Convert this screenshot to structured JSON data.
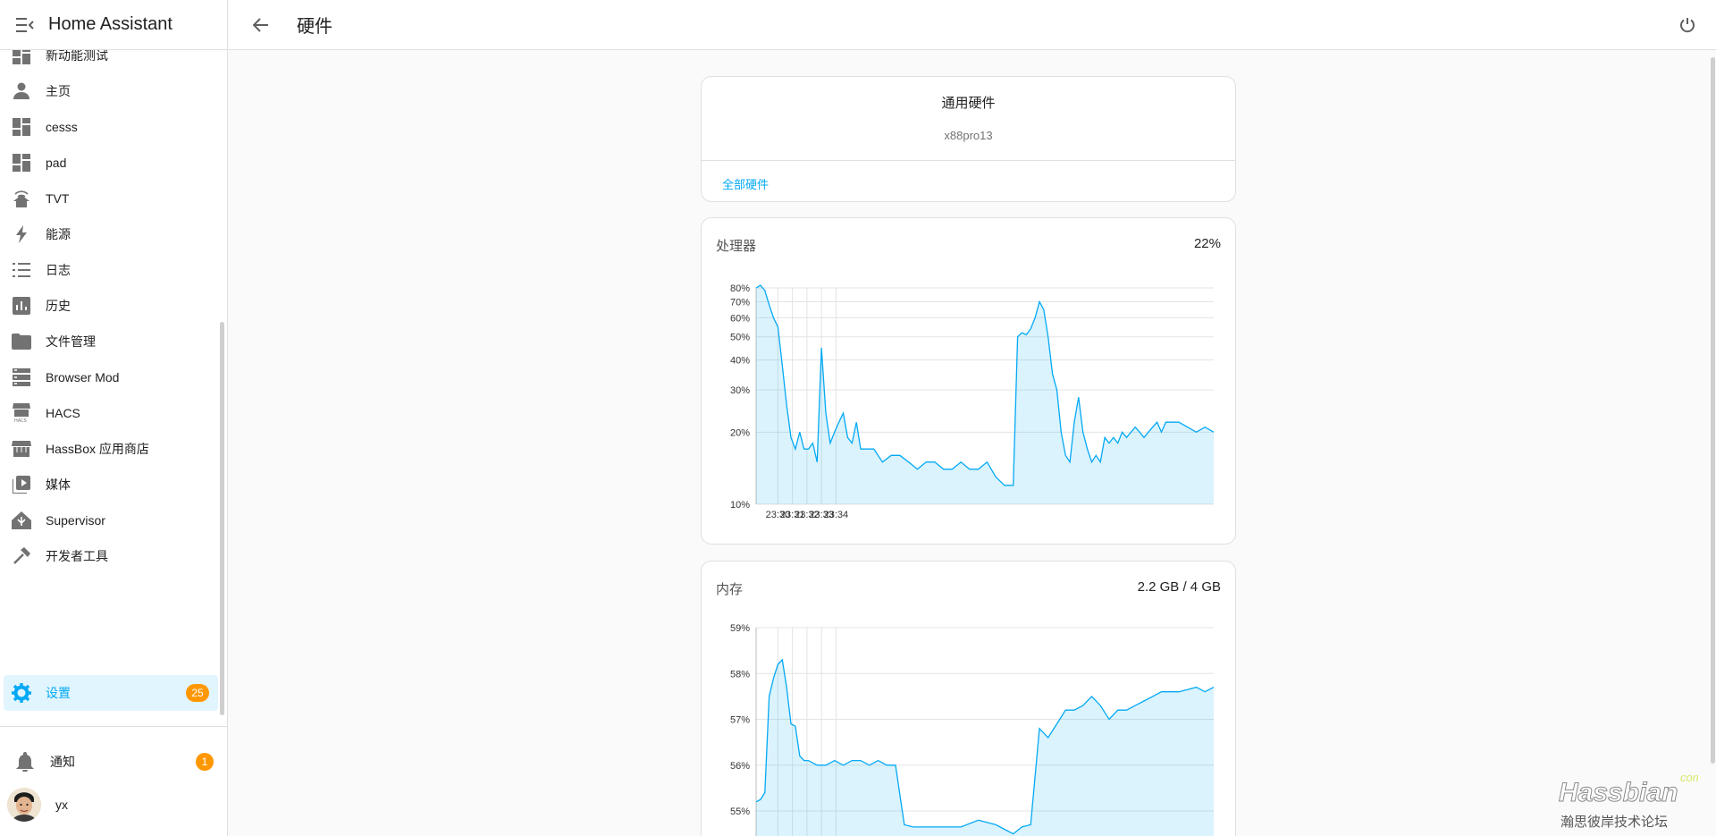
{
  "app": {
    "title": "Home Assistant"
  },
  "sidebar": {
    "partial_item": "新动能测试",
    "items": [
      {
        "label": "主页",
        "icon": "person-icon"
      },
      {
        "label": "cesss",
        "icon": "dashboard-icon"
      },
      {
        "label": "pad",
        "icon": "dashboard-icon"
      },
      {
        "label": "TVT",
        "icon": "home-signal-icon"
      },
      {
        "label": "能源",
        "icon": "lightning-icon"
      },
      {
        "label": "日志",
        "icon": "list-icon"
      },
      {
        "label": "历史",
        "icon": "chart-box-icon"
      },
      {
        "label": "文件管理",
        "icon": "folder-icon"
      },
      {
        "label": "Browser Mod",
        "icon": "server-icon"
      },
      {
        "label": "HACS",
        "icon": "hacs-store-icon"
      },
      {
        "label": "HassBox 应用商店",
        "icon": "store-icon"
      },
      {
        "label": "媒体",
        "icon": "play-box-icon"
      },
      {
        "label": "Supervisor",
        "icon": "supervisor-icon"
      },
      {
        "label": "开发者工具",
        "icon": "hammer-icon"
      },
      {
        "label": "设置",
        "icon": "gear-icon",
        "badge": "25",
        "active": true
      }
    ],
    "notifications": {
      "label": "通知",
      "badge": "1"
    },
    "user": {
      "name": "yx"
    }
  },
  "header": {
    "title": "硬件"
  },
  "general": {
    "title": "通用硬件",
    "subtitle": "x88pro13",
    "link": "全部硬件"
  },
  "cpu": {
    "label": "处理器",
    "value": "22%"
  },
  "memory": {
    "label": "内存",
    "value": "2.2 GB / 4 GB"
  },
  "watermark": {
    "brand": "Hassbian",
    "suffix": "com",
    "tagline": "瀚思彼岸技术论坛"
  },
  "chart_data": [
    {
      "type": "area",
      "name": "cpu",
      "y_ticks": [
        "10%",
        "20%",
        "30%",
        "40%",
        "50%",
        "60%",
        "70%",
        "80%"
      ],
      "x_ticks": [
        "23:30",
        "23:31",
        "23:32",
        "23:33",
        "23:34"
      ],
      "y_log": true,
      "ylim": [
        10,
        80
      ],
      "xlim": [
        23.475,
        24.0
      ],
      "x": [
        23.475,
        23.48,
        23.485,
        23.49,
        23.495,
        23.5,
        23.505,
        23.51,
        23.515,
        23.52,
        23.525,
        23.53,
        23.535,
        23.54,
        23.545,
        23.55,
        23.555,
        23.56,
        23.565,
        23.57,
        23.575,
        23.58,
        23.585,
        23.59,
        23.595,
        23.6,
        23.61,
        23.62,
        23.63,
        23.64,
        23.65,
        23.66,
        23.67,
        23.68,
        23.69,
        23.7,
        23.71,
        23.72,
        23.73,
        23.74,
        23.75,
        23.76,
        23.765,
        23.77,
        23.775,
        23.78,
        23.785,
        23.79,
        23.795,
        23.8,
        23.805,
        23.81,
        23.815,
        23.82,
        23.825,
        23.83,
        23.835,
        23.84,
        23.845,
        23.85,
        23.855,
        23.86,
        23.865,
        23.87,
        23.875,
        23.88,
        23.885,
        23.89,
        23.895,
        23.9,
        23.905,
        23.91,
        23.915,
        23.92,
        23.925,
        23.93,
        23.935,
        23.94,
        23.945,
        23.95,
        23.96,
        23.97,
        23.98,
        23.99,
        24.0
      ],
      "values": [
        80,
        82,
        78,
        68,
        60,
        55,
        38,
        26,
        19,
        17,
        20,
        17,
        17,
        18,
        15,
        45,
        24,
        18,
        20,
        22,
        24,
        19,
        18,
        22,
        17,
        17,
        17,
        15,
        16,
        16,
        15,
        14,
        15,
        15,
        14,
        14,
        15,
        14,
        14,
        15,
        13,
        12,
        12,
        12,
        50,
        52,
        51,
        54,
        60,
        70,
        65,
        50,
        35,
        30,
        20,
        16,
        15,
        22,
        28,
        20,
        17,
        15,
        16,
        15,
        19,
        18,
        19,
        18,
        20,
        19,
        20,
        21,
        20,
        19,
        20,
        21,
        22,
        20,
        22,
        22,
        22,
        21,
        20,
        21,
        20
      ]
    },
    {
      "type": "area",
      "name": "memory",
      "y_ticks": [
        "55%",
        "56%",
        "57%",
        "58%",
        "59%"
      ],
      "ylim": [
        54.2,
        59
      ],
      "xlim": [
        23.475,
        24.0
      ],
      "x": [
        23.475,
        23.48,
        23.485,
        23.49,
        23.495,
        23.5,
        23.505,
        23.51,
        23.515,
        23.52,
        23.525,
        23.53,
        23.535,
        23.545,
        23.555,
        23.565,
        23.575,
        23.585,
        23.595,
        23.605,
        23.615,
        23.625,
        23.635,
        23.645,
        23.655,
        23.665,
        23.675,
        23.685,
        23.695,
        23.71,
        23.73,
        23.75,
        23.76,
        23.77,
        23.78,
        23.79,
        23.8,
        23.81,
        23.82,
        23.83,
        23.84,
        23.85,
        23.86,
        23.87,
        23.88,
        23.89,
        23.9,
        23.91,
        23.92,
        23.93,
        23.94,
        23.95,
        23.96,
        23.97,
        23.98,
        23.99,
        24.0
      ],
      "values": [
        55.2,
        55.25,
        55.4,
        57.5,
        57.9,
        58.2,
        58.3,
        57.7,
        56.9,
        56.85,
        56.2,
        56.1,
        56.1,
        56.0,
        56.0,
        56.1,
        56.0,
        56.1,
        56.1,
        56.0,
        56.1,
        56.0,
        56.0,
        54.7,
        54.65,
        54.65,
        54.65,
        54.65,
        54.65,
        54.65,
        54.8,
        54.7,
        54.6,
        54.5,
        54.65,
        54.7,
        56.8,
        56.6,
        56.9,
        57.2,
        57.2,
        57.3,
        57.5,
        57.3,
        57.0,
        57.2,
        57.2,
        57.3,
        57.4,
        57.5,
        57.6,
        57.6,
        57.6,
        57.65,
        57.7,
        57.6,
        57.7
      ]
    }
  ]
}
